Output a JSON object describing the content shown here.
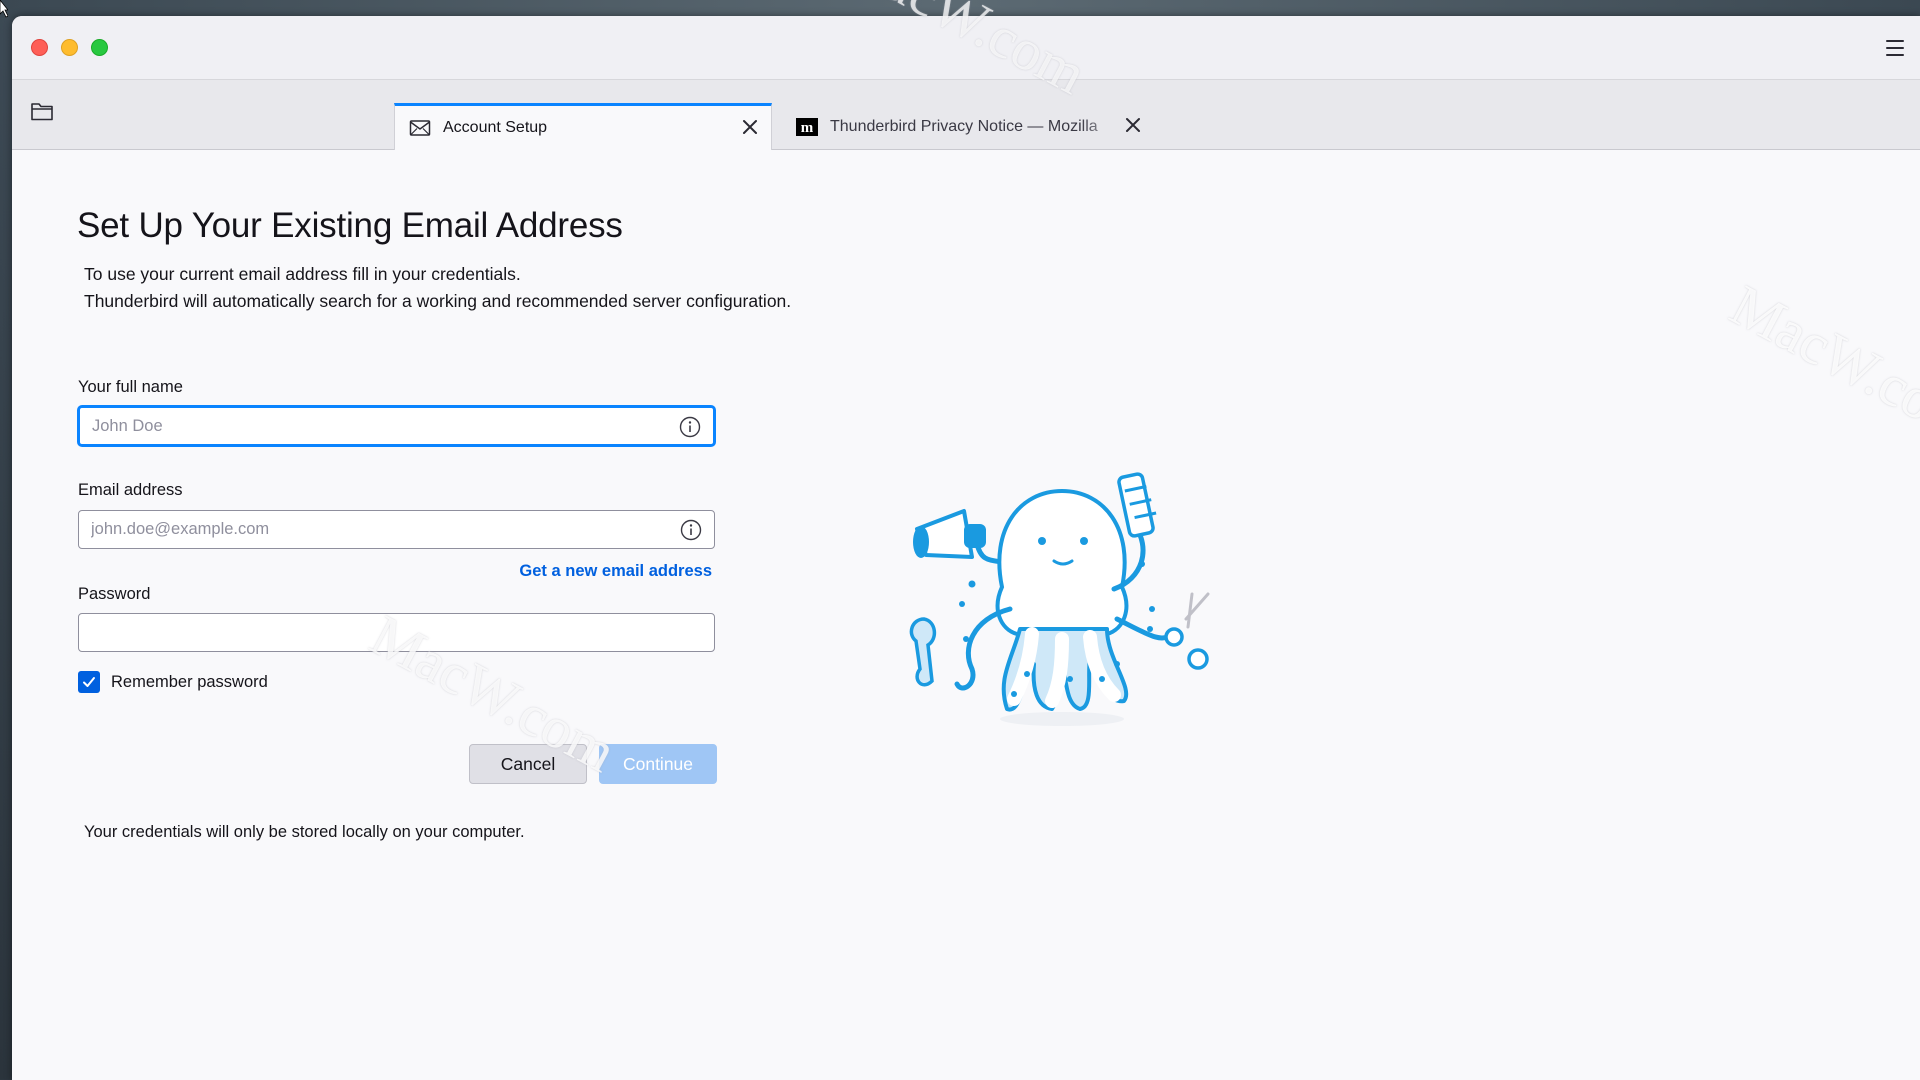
{
  "window": {
    "menu_icon": "hamburger-menu-icon"
  },
  "tabs": [
    {
      "label": "Account Setup",
      "icon": "mail-setup-icon",
      "active": true
    },
    {
      "label": "Thunderbird Privacy Notice — Mozilla",
      "icon": "mozilla-m-icon",
      "active": false
    }
  ],
  "page": {
    "title": "Set Up Your Existing Email Address",
    "intro_line1": "To use your current email address fill in your credentials.",
    "intro_line2": "Thunderbird will automatically search for a working and recommended server configuration."
  },
  "form": {
    "full_name": {
      "label": "Your full name",
      "placeholder": "John Doe",
      "value": ""
    },
    "email": {
      "label": "Email address",
      "placeholder": "john.doe@example.com",
      "value": ""
    },
    "new_email_link": "Get a new email address",
    "password": {
      "label": "Password",
      "value": ""
    },
    "remember_password": {
      "label": "Remember password",
      "checked": true
    },
    "cancel_label": "Cancel",
    "continue_label": "Continue",
    "footnote": "Your credentials will only be stored locally on your computer."
  },
  "watermark": "MacW.com",
  "colors": {
    "accent": "#0a84ff",
    "link": "#0060df",
    "continue_disabled": "#9fc6f5",
    "mascot": "#1a9ae0"
  }
}
